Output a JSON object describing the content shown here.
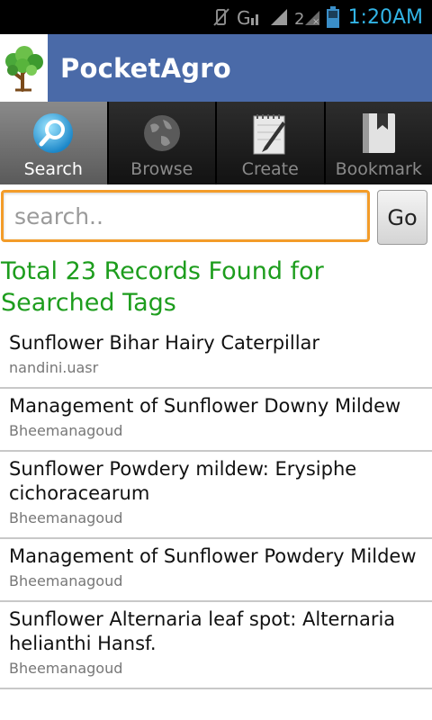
{
  "status_bar": {
    "time": "1:20AM",
    "icons": [
      "vibrate-mute-icon",
      "network-g-icon",
      "signal-icon",
      "unknown-sim-icon",
      "battery-icon"
    ]
  },
  "app": {
    "title": "PocketAgro",
    "colors": {
      "app_bar": "#4a6aa8",
      "accent": "#f39c29",
      "results_title": "#1d9d1d"
    }
  },
  "tabs": [
    {
      "label": "Search",
      "icon": "search-icon",
      "active": true
    },
    {
      "label": "Browse",
      "icon": "globe-icon",
      "active": false
    },
    {
      "label": "Create",
      "icon": "notepad-pencil-icon",
      "active": false
    },
    {
      "label": "Bookmark",
      "icon": "bookmark-icon",
      "active": false
    }
  ],
  "search": {
    "placeholder": "search..",
    "value": "",
    "go_label": "Go"
  },
  "results": {
    "title": "Total 23 Records Found for Searched Tags",
    "items": [
      {
        "title": "Sunflower Bihar Hairy Caterpillar",
        "author": "nandini.uasr"
      },
      {
        "title": "Management of Sunflower Downy Mildew",
        "author": "Bheemanagoud"
      },
      {
        "title": "Sunflower Powdery mildew: Erysiphe cichoracearum",
        "author": "Bheemanagoud"
      },
      {
        "title": "Management of Sunflower Powdery Mildew",
        "author": "Bheemanagoud"
      },
      {
        "title": "Sunflower Alternaria leaf spot: Alternaria helianthi Hansf.",
        "author": "Bheemanagoud"
      }
    ]
  }
}
